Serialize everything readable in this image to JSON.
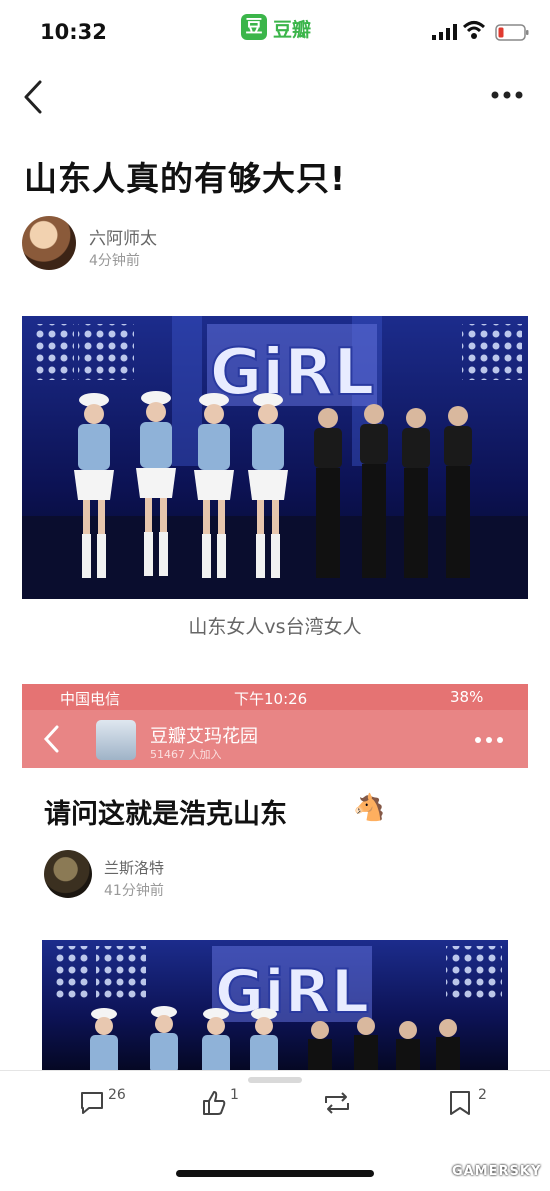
{
  "status_bar": {
    "time": "10:32",
    "app_badge": "豆",
    "app_name": "豆瓣"
  },
  "post": {
    "title": "山东人真的有够大只!",
    "author": "六阿师太",
    "time_ago": "4分钟前",
    "image_caption": "山东女人vs台湾女人",
    "stage_sign": "GiRL"
  },
  "embedded": {
    "status": {
      "carrier": "中国电信",
      "time": "下午10:26",
      "battery": "38%"
    },
    "group_name": "豆瓣艾玛花园",
    "group_members": "51467 人加入",
    "question": "请问这就是浩克山东",
    "emoji": "🐴",
    "author": "兰斯洛特",
    "time_ago": "41分钟前"
  },
  "actions": {
    "comments": "26",
    "likes": "1",
    "bookmarks": "2"
  },
  "watermark": "GAMERSKY",
  "colors": {
    "douban_green": "#3bb54a",
    "embed_red": "#e57373"
  },
  "icons": [
    "back-icon",
    "more-icon",
    "comment-icon",
    "like-icon",
    "repost-icon",
    "bookmark-icon"
  ]
}
